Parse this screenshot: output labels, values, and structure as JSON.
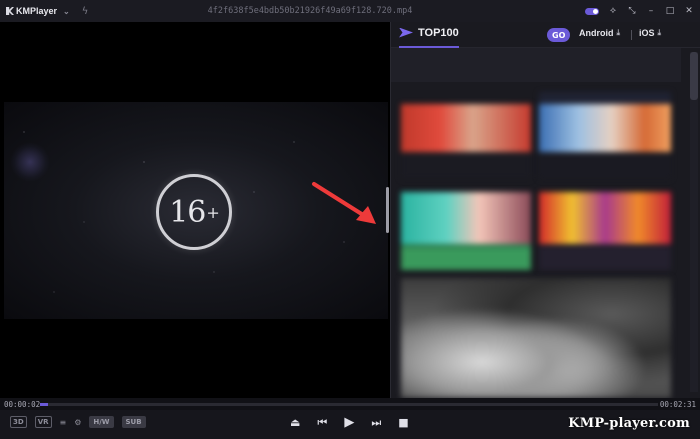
{
  "window": {
    "app_name": "KMPlayer",
    "dropdown_icon": "chevron-down",
    "file_name": "4f2f638f5e4bdb50b21926f49a69f128.720.mp4",
    "title_icons": [
      "toggle-switch",
      "pin-icon",
      "compact-icon",
      "minimize-icon",
      "maximize-icon",
      "close-icon"
    ],
    "accent_color": "#6b5ad8"
  },
  "video": {
    "rating_number": "16",
    "rating_plus": "+"
  },
  "panel": {
    "title": "TOP100",
    "go_label": "GO",
    "android_label": "Android",
    "ios_label": "iOS",
    "download_glyph": "⤓"
  },
  "playback": {
    "current_time": "00:00:02",
    "total_time": "00:02:31",
    "progress_fraction": 0.013
  },
  "controls": {
    "mode_3d": "3D",
    "mode_vr": "VR",
    "hw_badge": "H/W",
    "sub_badge": "SUB"
  },
  "watermark": "KMP-player.com"
}
